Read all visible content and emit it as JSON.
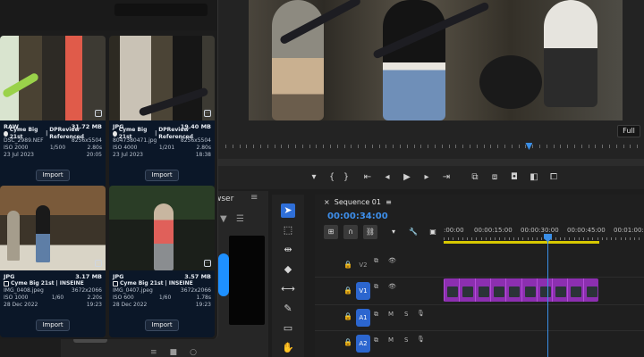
{
  "monitor": {
    "zoom": "Full",
    "transport_icons": [
      "marker-icon",
      "mark-in-icon",
      "mark-out-icon",
      "go-to-in-icon",
      "step-back-icon",
      "play-icon",
      "step-forward-icon",
      "go-to-out-icon",
      "insert-icon",
      "overwrite-icon",
      "export-frame-icon",
      "comparison-view-icon",
      "multi-camera-icon"
    ],
    "playhead_fraction": 0.73
  },
  "browser": {
    "tab_label": "wser"
  },
  "import_cards": [
    {
      "format": "RAW",
      "size": "31.72 MB",
      "ref_name": "Cyme Big 21st",
      "ref_link": "DPReview Referenced",
      "filename": "DSC_2989.NEF",
      "dimensions": "8256x5504",
      "iso": "ISO 2000",
      "shutter": "1/500",
      "aperture": "2.80s",
      "date": "23 Jul 2023",
      "time": "20:05",
      "import_label": "Import"
    },
    {
      "format": "JPG",
      "size": "19.40 MB",
      "ref_name": "Cyme Big 21st",
      "ref_link": "DPReview Referenced",
      "filename": "8047380471.jpg",
      "dimensions": "8256x5504",
      "iso": "ISO 4000",
      "shutter": "1/201",
      "aperture": "2.80s",
      "date": "23 Jul 2023",
      "time": "18:38",
      "import_label": "Import"
    },
    {
      "format": "JPG",
      "size": "3.17 MB",
      "ref_name": "Cyme Big 21st",
      "ref_link": "INSEINE",
      "filename": "IMG_0408.jpeg",
      "dimensions": "3672x2066",
      "iso": "ISO 1000",
      "shutter": "1/60",
      "aperture": "2.20s",
      "date": "28 Dec 2022",
      "time": "19:23",
      "import_label": "Import"
    },
    {
      "format": "JPG",
      "size": "3.57 MB",
      "ref_name": "Cyme Big 21st",
      "ref_link": "INSEINE",
      "filename": "IMG_0407.jpeg",
      "dimensions": "3672x2066",
      "iso": "ISO 600",
      "shutter": "1/60",
      "aperture": "1.78s",
      "date": "28 Dec 2022",
      "time": "19:23",
      "import_label": "Import"
    }
  ],
  "timeline": {
    "sequence_name": "Sequence 01",
    "timecode": "00:00:34:00",
    "ruler_times": [
      ":00:00",
      "00:00:15:00",
      "00:00:30:00",
      "00:00:45:00",
      "00:01:00:0"
    ],
    "tracks": [
      {
        "name": "V2",
        "type": "video",
        "targeted": false
      },
      {
        "name": "V1",
        "type": "video",
        "targeted": true
      },
      {
        "name": "A1",
        "type": "audio",
        "targeted": true
      },
      {
        "name": "A2",
        "type": "audio",
        "targeted": true
      }
    ],
    "audio_toggles": [
      "M",
      "S"
    ]
  },
  "tools": [
    "selection-tool-icon",
    "track-select-tool-icon",
    "ripple-edit-tool-icon",
    "razor-tool-icon",
    "slip-tool-icon",
    "pen-tool-icon",
    "rectangle-tool-icon",
    "hand-tool-icon"
  ],
  "colors": {
    "accent": "#2f6fd8",
    "timecode": "#3d8eea",
    "clip": "#8c2fb0",
    "work_area": "#d7c800",
    "card_bg": "#0b1728"
  }
}
